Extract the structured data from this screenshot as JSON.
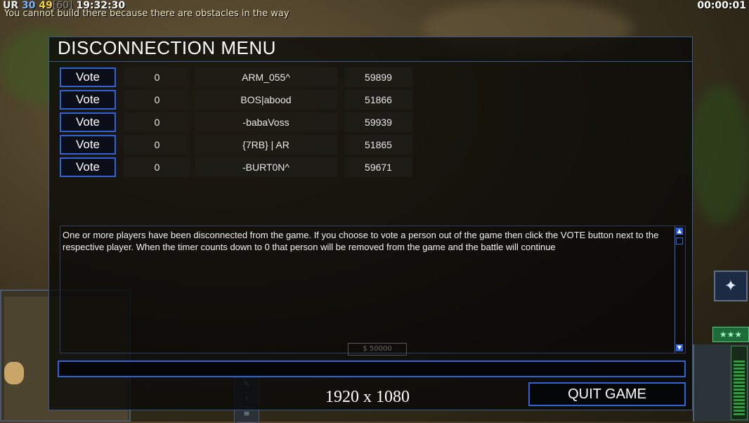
{
  "hud": {
    "prefix": "UR",
    "money": "30",
    "power": "49",
    "max_power": "[60]",
    "time": "19:32:30",
    "message": "You cannot build there because there are obstacles in the way",
    "game_timer": "00:00:01",
    "side_money": "$ 50000",
    "rank_stars": "★★★"
  },
  "menu": {
    "title": "DISCONNECTION MENU",
    "vote_label": "Vote",
    "players": [
      {
        "votes": "0",
        "name": "ARM_055^",
        "ping": "59899"
      },
      {
        "votes": "0",
        "name": "BOS|abood",
        "ping": "51866"
      },
      {
        "votes": "0",
        "name": "-babaVoss",
        "ping": "59939"
      },
      {
        "votes": "0",
        "name": "{7RB} | AR",
        "ping": "51865"
      },
      {
        "votes": "0",
        "name": "-BURT0N^",
        "ping": "59671"
      }
    ],
    "message": "One or more players have been disconnected from the game. If you choose to vote a person out of the game then click the VOTE button next to the respective player. When the timer counts down to 0 that person will be removed from the game and the battle will continue",
    "chat_value": "",
    "quit_label": "QUIT GAME"
  },
  "overlay": {
    "resolution": "1920 x 1080"
  },
  "colors": {
    "accent_border": "#2f63d8",
    "panel_bg": "#080806"
  }
}
